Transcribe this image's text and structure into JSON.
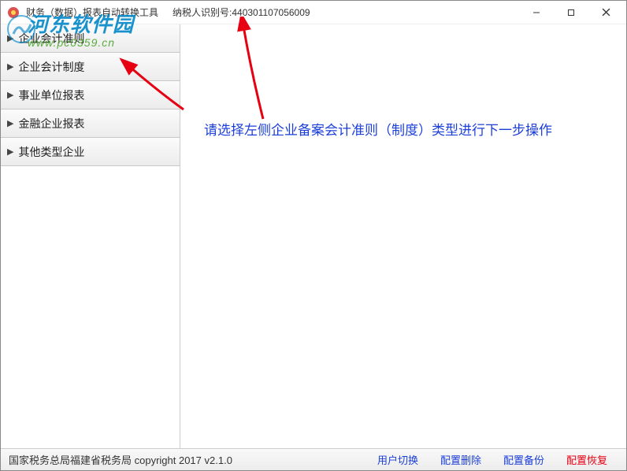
{
  "titlebar": {
    "appTitle": "财务（数据）报表自动转换工具",
    "taxLabel": "纳税人识别号:",
    "taxId": "440301107056009"
  },
  "sidebar": {
    "items": [
      {
        "label": "企业会计准则"
      },
      {
        "label": "企业会计制度"
      },
      {
        "label": "事业单位报表"
      },
      {
        "label": "金融企业报表"
      },
      {
        "label": "其他类型企业"
      }
    ]
  },
  "main": {
    "instruction": "请选择左侧企业备案会计准则（制度）类型进行下一步操作"
  },
  "statusbar": {
    "left": "国家税务总局福建省税务局  copyright 2017  v2.1.0",
    "actions": {
      "userSwitch": "用户切换",
      "configDelete": "配置删除",
      "configBackup": "配置备份",
      "configRestore": "配置恢复"
    }
  },
  "watermark": {
    "cn": "河东软件园",
    "url": "www.pc0359.cn"
  }
}
